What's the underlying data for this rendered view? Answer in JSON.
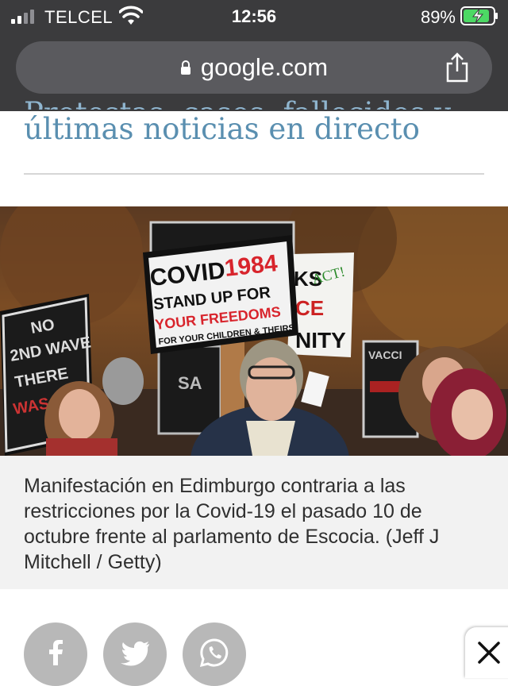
{
  "status_bar": {
    "carrier": "TELCEL",
    "time": "12:56",
    "battery": "89%",
    "battery_level": 0.89
  },
  "browser": {
    "url": "google.com"
  },
  "article": {
    "headline_partial": "Protestas, casos, fallecidos y",
    "headline": "últimas noticias en directo",
    "caption": "Manifestación en Edimburgo contraria a las restricciones por la Covid-19 el pasado 10 de octubre frente al parlamento de Escocia. (Jeff J Mitchell / Getty)"
  },
  "photo_signs": {
    "sign_main_1": "COVID",
    "sign_main_2": "1984",
    "sign_main_3": "STAND UP FOR",
    "sign_main_4": "YOUR FREEDOMS",
    "sign_main_5": "FOR YOUR CHILDREN & THEIRS",
    "sign_left": "NO 2ND WAVE THERE WAS",
    "sign_right": "KS ACT! CE NITY",
    "sign_far_right": "VACCI"
  },
  "share": {
    "icons": [
      "facebook-icon",
      "twitter-icon",
      "whatsapp-icon"
    ]
  },
  "colors": {
    "headline": "#5a8fb0",
    "chrome": "#3b3b3d",
    "battery": "#4cd964"
  }
}
